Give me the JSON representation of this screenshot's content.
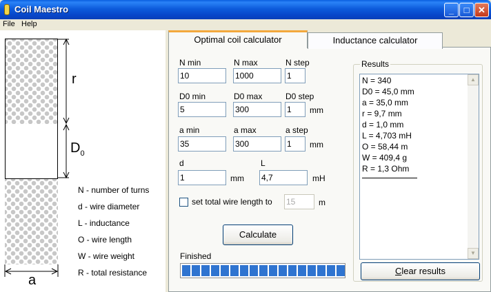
{
  "window": {
    "title": "Coil Maestro",
    "minimize": "_",
    "maximize": "□",
    "close": "✕"
  },
  "menu": {
    "items": [
      "File",
      "Help"
    ]
  },
  "diagram": {
    "r_label": "r",
    "d0_label": "D",
    "d0_sub": "0",
    "a_label": "a",
    "legend": [
      "N - number of turns",
      "d - wire diameter",
      "L - inductance",
      "O - wire length",
      "W - wire weight",
      "R - total resistance"
    ]
  },
  "tabs": [
    {
      "label": "Optimal coil calculator",
      "active": true
    },
    {
      "label": "Inductance calculator",
      "active": false
    }
  ],
  "form": {
    "n_min": {
      "label": "N min",
      "value": "10"
    },
    "n_max": {
      "label": "N max",
      "value": "1000"
    },
    "n_step": {
      "label": "N step",
      "value": "1"
    },
    "d0_min": {
      "label": "D0 min",
      "value": "5"
    },
    "d0_max": {
      "label": "D0 max",
      "value": "300"
    },
    "d0_step": {
      "label": "D0 step",
      "value": "1",
      "unit": "mm"
    },
    "a_min": {
      "label": "a min",
      "value": "35"
    },
    "a_max": {
      "label": "a max",
      "value": "300"
    },
    "a_step": {
      "label": "a step",
      "value": "1",
      "unit": "mm"
    },
    "d": {
      "label": "d",
      "value": "1",
      "unit": "mm"
    },
    "L": {
      "label": "L",
      "value": "4,7",
      "unit": "mH"
    },
    "total_length": {
      "checkbox_label": "set total wire length to",
      "value": "15",
      "unit": "m",
      "checked": false
    },
    "calculate_button": "Calculate"
  },
  "status": {
    "text": "Finished",
    "progress": 1.0
  },
  "results": {
    "group_label": "Results",
    "lines": [
      "N = 340",
      "D0 = 45,0 mm",
      "a = 35,0 mm",
      "r = 9,7 mm",
      "d = 1,0 mm",
      "L = 4,703 mH",
      "O = 58,44 m",
      "W = 409,4 g",
      "R = 1,3 Ohm"
    ],
    "clear_button": "Clear results"
  }
}
